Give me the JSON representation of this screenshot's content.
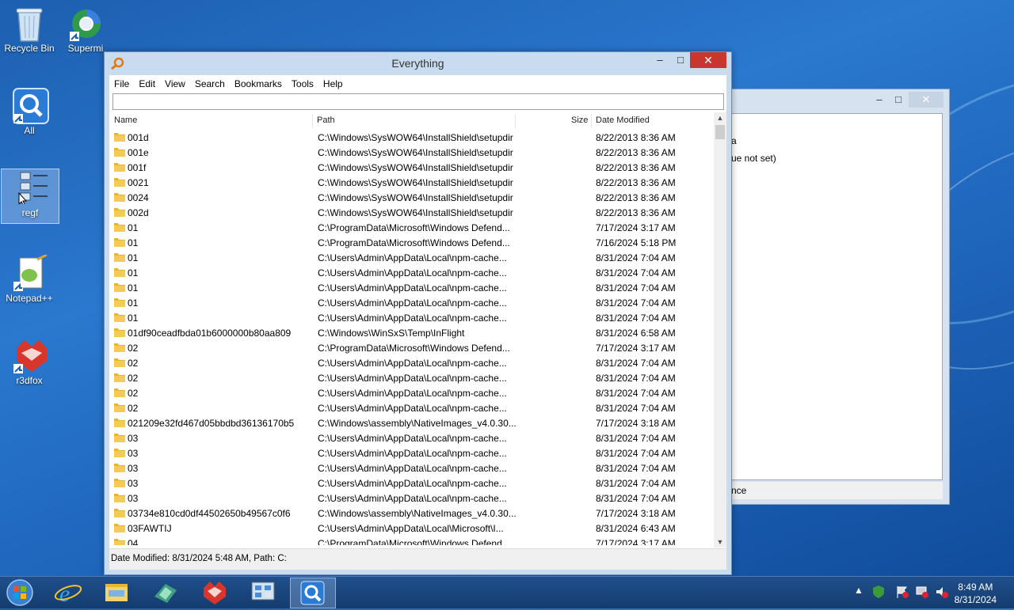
{
  "desktop": {
    "icons": [
      {
        "label": "Recycle Bin"
      },
      {
        "label": "Supermi"
      },
      {
        "label": "All"
      },
      {
        "label": "regf"
      },
      {
        "label": "Notepad++"
      },
      {
        "label": "r3dfox"
      }
    ]
  },
  "bg_window": {
    "line1": "a",
    "line2": "ue not set)",
    "status": "nce"
  },
  "window": {
    "title": "Everything",
    "minimize_glyph": "–",
    "maximize_glyph": "□",
    "close_glyph": "✕",
    "menu": [
      "File",
      "Edit",
      "View",
      "Search",
      "Bookmarks",
      "Tools",
      "Help"
    ],
    "search_value": "",
    "columns": {
      "name": "Name",
      "path": "Path",
      "size": "Size",
      "date": "Date Modified"
    },
    "rows": [
      {
        "name": "001d",
        "path": "C:\\Windows\\SysWOW64\\InstallShield\\setupdir",
        "date": "8/22/2013 8:36 AM"
      },
      {
        "name": "001e",
        "path": "C:\\Windows\\SysWOW64\\InstallShield\\setupdir",
        "date": "8/22/2013 8:36 AM"
      },
      {
        "name": "001f",
        "path": "C:\\Windows\\SysWOW64\\InstallShield\\setupdir",
        "date": "8/22/2013 8:36 AM"
      },
      {
        "name": "0021",
        "path": "C:\\Windows\\SysWOW64\\InstallShield\\setupdir",
        "date": "8/22/2013 8:36 AM"
      },
      {
        "name": "0024",
        "path": "C:\\Windows\\SysWOW64\\InstallShield\\setupdir",
        "date": "8/22/2013 8:36 AM"
      },
      {
        "name": "002d",
        "path": "C:\\Windows\\SysWOW64\\InstallShield\\setupdir",
        "date": "8/22/2013 8:36 AM"
      },
      {
        "name": "01",
        "path": "C:\\ProgramData\\Microsoft\\Windows Defend...",
        "date": "7/17/2024 3:17 AM"
      },
      {
        "name": "01",
        "path": "C:\\ProgramData\\Microsoft\\Windows Defend...",
        "date": "7/16/2024 5:18 PM"
      },
      {
        "name": "01",
        "path": "C:\\Users\\Admin\\AppData\\Local\\npm-cache...",
        "date": "8/31/2024 7:04 AM"
      },
      {
        "name": "01",
        "path": "C:\\Users\\Admin\\AppData\\Local\\npm-cache...",
        "date": "8/31/2024 7:04 AM"
      },
      {
        "name": "01",
        "path": "C:\\Users\\Admin\\AppData\\Local\\npm-cache...",
        "date": "8/31/2024 7:04 AM"
      },
      {
        "name": "01",
        "path": "C:\\Users\\Admin\\AppData\\Local\\npm-cache...",
        "date": "8/31/2024 7:04 AM"
      },
      {
        "name": "01",
        "path": "C:\\Users\\Admin\\AppData\\Local\\npm-cache...",
        "date": "8/31/2024 7:04 AM"
      },
      {
        "name": "01df90ceadfbda01b6000000b80aa809",
        "path": "C:\\Windows\\WinSxS\\Temp\\InFlight",
        "date": "8/31/2024 6:58 AM"
      },
      {
        "name": "02",
        "path": "C:\\ProgramData\\Microsoft\\Windows Defend...",
        "date": "7/17/2024 3:17 AM"
      },
      {
        "name": "02",
        "path": "C:\\Users\\Admin\\AppData\\Local\\npm-cache...",
        "date": "8/31/2024 7:04 AM"
      },
      {
        "name": "02",
        "path": "C:\\Users\\Admin\\AppData\\Local\\npm-cache...",
        "date": "8/31/2024 7:04 AM"
      },
      {
        "name": "02",
        "path": "C:\\Users\\Admin\\AppData\\Local\\npm-cache...",
        "date": "8/31/2024 7:04 AM"
      },
      {
        "name": "02",
        "path": "C:\\Users\\Admin\\AppData\\Local\\npm-cache...",
        "date": "8/31/2024 7:04 AM"
      },
      {
        "name": "021209e32fd467d05bbdbd36136170b5",
        "path": "C:\\Windows\\assembly\\NativeImages_v4.0.30...",
        "date": "7/17/2024 3:18 AM"
      },
      {
        "name": "03",
        "path": "C:\\Users\\Admin\\AppData\\Local\\npm-cache...",
        "date": "8/31/2024 7:04 AM"
      },
      {
        "name": "03",
        "path": "C:\\Users\\Admin\\AppData\\Local\\npm-cache...",
        "date": "8/31/2024 7:04 AM"
      },
      {
        "name": "03",
        "path": "C:\\Users\\Admin\\AppData\\Local\\npm-cache...",
        "date": "8/31/2024 7:04 AM"
      },
      {
        "name": "03",
        "path": "C:\\Users\\Admin\\AppData\\Local\\npm-cache...",
        "date": "8/31/2024 7:04 AM"
      },
      {
        "name": "03",
        "path": "C:\\Users\\Admin\\AppData\\Local\\npm-cache...",
        "date": "8/31/2024 7:04 AM"
      },
      {
        "name": "03734e810cd0df44502650b49567c0f6",
        "path": "C:\\Windows\\assembly\\NativeImages_v4.0.30...",
        "date": "7/17/2024 3:18 AM"
      },
      {
        "name": "03FAWTIJ",
        "path": "C:\\Users\\Admin\\AppData\\Local\\Microsoft\\I...",
        "date": "8/31/2024 6:43 AM"
      },
      {
        "name": "04",
        "path": "C:\\ProgramData\\Microsoft\\Windows Defend...",
        "date": "7/17/2024 3:17 AM"
      }
    ],
    "status": "Date Modified: 8/31/2024 5:48 AM, Path: C:"
  },
  "taskbar": {
    "apps": [
      "start-button",
      "internet-explorer",
      "file-explorer",
      "regf-app",
      "r3dfox-app",
      "network-app",
      "everything-app"
    ],
    "active_app": "everything-app",
    "clock_time": "8:49 AM",
    "clock_date": "8/31/2024"
  },
  "colors": {
    "folder": "#e8b632",
    "close": "#c7372f",
    "taskbar": "#1f4f8c"
  }
}
